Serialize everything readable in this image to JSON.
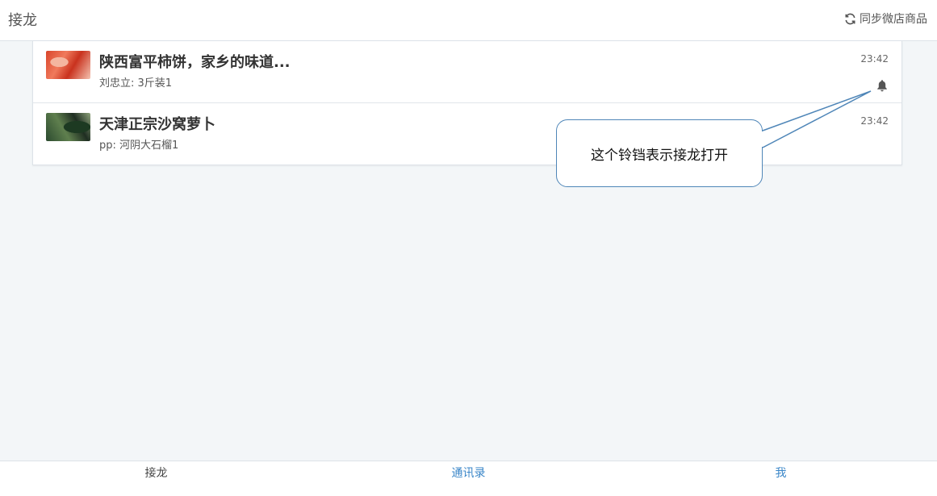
{
  "header": {
    "title": "接龙",
    "sync_label": "同步微店商品",
    "sync_icon": "refresh-icon"
  },
  "items": [
    {
      "title": "陕西富平柿饼，家乡的味道...",
      "subtitle": "刘忠立: 3斤装1",
      "time": "23:42",
      "has_bell": true
    },
    {
      "title": "天津正宗沙窝萝卜",
      "subtitle": "pp: 河阴大石榴1",
      "time": "23:42",
      "has_bell": false
    }
  ],
  "callout": {
    "text": "这个铃铛表示接龙打开"
  },
  "tabs": [
    {
      "label": "接龙",
      "active": true
    },
    {
      "label": "通讯录",
      "active": false
    },
    {
      "label": "我",
      "active": false
    }
  ],
  "colors": {
    "accent": "#3a86c8",
    "callout_border": "#4f86b8",
    "background": "#f3f6f8"
  }
}
